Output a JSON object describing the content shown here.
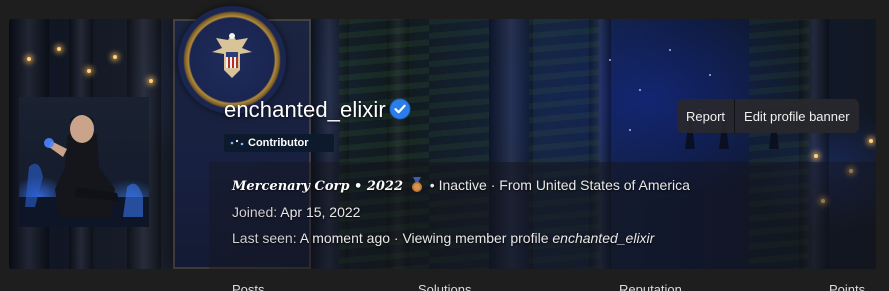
{
  "profile": {
    "username": "enchanted_elixir",
    "role": "Contributor",
    "faction": "Mercenary Corp • 2022",
    "status": "• Inactive · From United States of America",
    "joined_label": "Joined:",
    "joined_value": "Apr 15, 2022",
    "last_seen_label": "Last seen:",
    "last_seen_value": "A moment ago · Viewing member profile",
    "last_seen_target": "enchanted_elixir"
  },
  "actions": {
    "report": "Report",
    "edit_banner": "Edit profile banner"
  },
  "stats": [
    "Posts",
    "Solutions",
    "Reputation",
    "Points"
  ],
  "icons": {
    "verified": "verified-check-icon",
    "medal": "bronze-medal-icon"
  },
  "colors": {
    "background": "#1e1e1e",
    "verified": "#2b7de9",
    "badge_bg": "#0d1a2d",
    "button_bg": "#28282c"
  }
}
